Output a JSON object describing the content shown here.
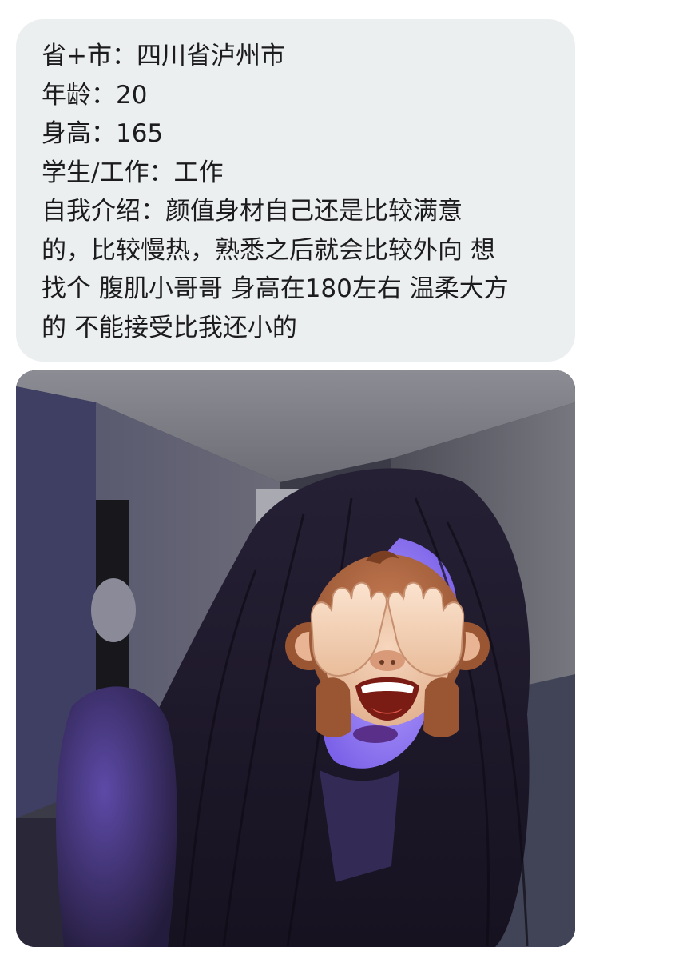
{
  "message": {
    "lines": [
      "省+市：四川省泸州市",
      "年龄：20",
      "身高：165",
      "学生/工作：工作",
      "自我介绍：颜值身材自己还是比较满意",
      "的，比较慢热，熟悉之后就会比较外向 想",
      "找个 腹肌小哥哥 身高在180左右 温柔大方",
      "的 不能接受比我还小的"
    ]
  },
  "photo": {
    "overlay_icon": "see-no-evil-monkey-icon",
    "colors": {
      "bubble_bg": "#eceff0",
      "text": "#1c1c1e",
      "purple_light": "#8f78ff"
    }
  }
}
